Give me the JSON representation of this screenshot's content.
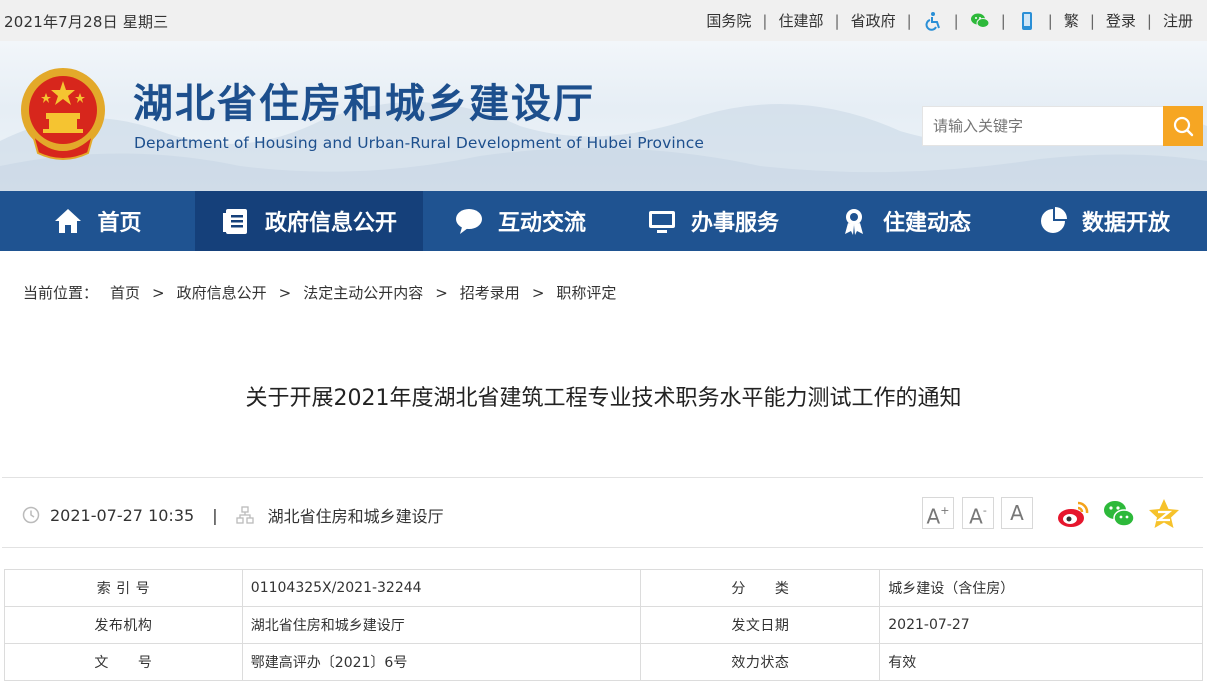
{
  "topbar": {
    "date": "2021年7月28日 星期三",
    "links": [
      "国务院",
      "住建部",
      "省政府"
    ],
    "icons": [
      "accessibility-icon",
      "wechat-icon",
      "mobile-icon"
    ],
    "traditional": "繁",
    "login": "登录",
    "register": "注册",
    "separator": "|"
  },
  "header": {
    "title": "湖北省住房和城乡建设厅",
    "subtitle": "Department of Housing and Urban-Rural Development of Hubei Province",
    "search_placeholder": "请输入关键字"
  },
  "nav": {
    "items": [
      {
        "label": "首页",
        "icon": "home-icon"
      },
      {
        "label": "政府信息公开",
        "icon": "document-list-icon",
        "active": true
      },
      {
        "label": "互动交流",
        "icon": "speech-bubble-icon"
      },
      {
        "label": "办事服务",
        "icon": "monitor-icon"
      },
      {
        "label": "住建动态",
        "icon": "award-ribbon-icon"
      },
      {
        "label": "数据开放",
        "icon": "pie-chart-icon"
      }
    ]
  },
  "breadcrumb": {
    "lead": "当前位置：",
    "items": [
      "首页",
      "政府信息公开",
      "法定主动公开内容",
      "招考录用",
      "职称评定"
    ],
    "arrow": ">"
  },
  "article": {
    "title": "关于开展2021年度湖北省建筑工程专业技术职务水平能力测试工作的通知",
    "datetime": "2021-07-27 10:35",
    "divider": "|",
    "publisher": "湖北省住房和城乡建设厅",
    "font_buttons": [
      "A+",
      "A-",
      "A"
    ]
  },
  "share": [
    "weibo-icon",
    "wechat-share-icon",
    "qzone-star-icon"
  ],
  "info_table": [
    {
      "k1": "索 引 号",
      "v1": "01104325X/2021-32244",
      "k2": "分　　类",
      "v2": "城乡建设（含住房）"
    },
    {
      "k1": "发布机构",
      "v1": "湖北省住房和城乡建设厅",
      "k2": "发文日期",
      "v2": "2021-07-27"
    },
    {
      "k1": "文　　号",
      "v1": "鄂建高评办〔2021〕6号",
      "k2": "效力状态",
      "v2": "有效"
    }
  ],
  "colors": {
    "nav_bg": "#1f5391",
    "nav_active": "#15407a",
    "title_blue": "#1d4f8d",
    "search_orange": "#f6a623"
  }
}
